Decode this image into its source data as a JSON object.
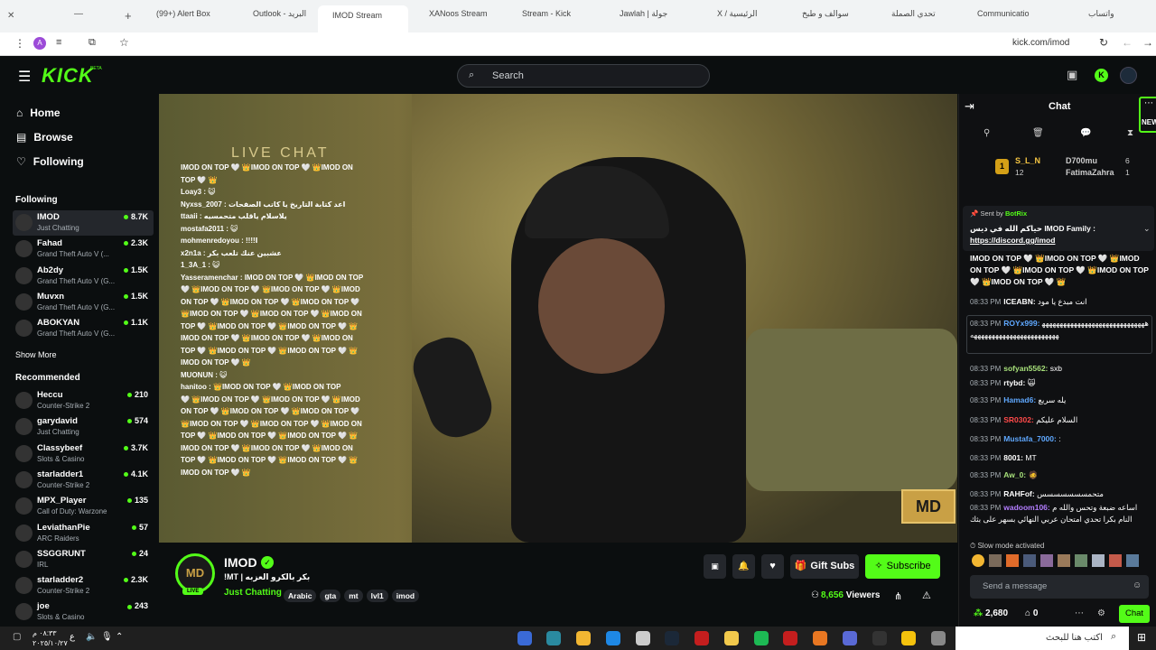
{
  "browser": {
    "tabs": [
      {
        "title": "(99+) Alert Box",
        "active": false
      },
      {
        "title": "Outlook - البريد",
        "active": false
      },
      {
        "title": "IMOD Stream",
        "active": true
      },
      {
        "title": "XANoos Stream",
        "active": false
      },
      {
        "title": "Stream - Kick",
        "active": false
      },
      {
        "title": "Jawlah | جولة",
        "active": false
      },
      {
        "title": "X / الرئيسية",
        "active": false
      },
      {
        "title": "سوالف و طبخ",
        "active": false
      },
      {
        "title": "تحدي الصملة",
        "active": false
      },
      {
        "title": "Communicatio",
        "active": false
      },
      {
        "title": "واتساب",
        "active": false
      }
    ],
    "url": "kick.com/imod"
  },
  "header": {
    "logo": "KICK",
    "logo_badge": "BETA",
    "search_placeholder": "Search"
  },
  "sidebar": {
    "nav": [
      "Home",
      "Browse",
      "Following"
    ],
    "following_title": "Following",
    "following": [
      {
        "name": "IMOD",
        "category": "Just Chatting",
        "viewers": "8.7K"
      },
      {
        "name": "Fahad",
        "category": "Grand Theft Auto V (...",
        "viewers": "2.3K"
      },
      {
        "name": "Ab2dy",
        "category": "Grand Theft Auto V (G...",
        "viewers": "1.5K"
      },
      {
        "name": "Muvxn",
        "category": "Grand Theft Auto V (G...",
        "viewers": "1.5K"
      },
      {
        "name": "ABOKYAN",
        "category": "Grand Theft Auto V (G...",
        "viewers": "1.1K"
      }
    ],
    "show_more": "Show More",
    "recommended_title": "Recommended",
    "recommended": [
      {
        "name": "Heccu",
        "category": "Counter-Strike 2",
        "viewers": "210"
      },
      {
        "name": "garydavid",
        "category": "Just Chatting",
        "viewers": "574"
      },
      {
        "name": "Classybeef",
        "category": "Slots & Casino",
        "viewers": "3.7K"
      },
      {
        "name": "starladder1",
        "category": "Counter-Strike 2",
        "viewers": "4.1K"
      },
      {
        "name": "MPX_Player",
        "category": "Call of Duty: Warzone",
        "viewers": "135"
      },
      {
        "name": "LeviathanPie",
        "category": "ARC Raiders",
        "viewers": "57"
      },
      {
        "name": "SSGGRUNT",
        "category": "IRL",
        "viewers": "24"
      },
      {
        "name": "starladder2",
        "category": "Counter-Strike 2",
        "viewers": "2.3K"
      },
      {
        "name": "joe",
        "category": "Slots & Casino",
        "viewers": "243"
      }
    ]
  },
  "video": {
    "overlay_title": "LIVE CHAT",
    "overlay_lines": [
      "IMOD ON TOP 🤍 👑IMOD ON TOP 🤍 👑IMOD ON",
      "TOP 🤍 👑",
      "Loay3 : 😺",
      "Nyxss_2007 : اعد كتابة التاريخ يا كاتب الصفحات",
      "ttaaii : يلاسلام ياقلب متحمسيه",
      "mostafa2011 : 😺",
      "mohmenredoyou : !!!!ا",
      "x2n1a : عشبين عنك تلعب بكر",
      "1_3A_1 : 😺",
      "Yasseramenchar : IMOD ON TOP 🤍 👑IMOD ON TOP",
      "🤍 👑IMOD ON TOP 🤍 👑IMOD ON TOP 🤍 👑IMOD",
      "ON TOP 🤍 👑IMOD ON TOP 🤍 👑IMOD ON TOP 🤍",
      "👑IMOD ON TOP 🤍 👑IMOD ON TOP 🤍 👑IMOD ON",
      "TOP 🤍 👑IMOD ON TOP 🤍 👑IMOD ON TOP 🤍 👑",
      "IMOD ON TOP 🤍 👑IMOD ON TOP 🤍 👑IMOD ON",
      "TOP 🤍 👑IMOD ON TOP 🤍 👑IMOD ON TOP 🤍 👑",
      "IMOD ON TOP 🤍 👑",
      "MUONUN : 😺",
      "hanitoo : 👑IMOD ON TOP 🤍 👑IMOD ON TOP",
      "🤍 👑IMOD ON TOP 🤍 👑IMOD ON TOP 🤍 👑IMOD",
      "ON TOP 🤍 👑IMOD ON TOP 🤍 👑IMOD ON TOP 🤍",
      "👑IMOD ON TOP 🤍 👑IMOD ON TOP 🤍 👑IMOD ON",
      "TOP 🤍 👑IMOD ON TOP 🤍 👑IMOD ON TOP 🤍 👑",
      "IMOD ON TOP 🤍 👑IMOD ON TOP 🤍 👑IMOD ON",
      "TOP 🤍 👑IMOD ON TOP 🤍 👑IMOD ON TOP 🤍 👑",
      "IMOD ON TOP 🤍 👑"
    ],
    "logo_text": "MD"
  },
  "stream": {
    "channel": "IMOD",
    "live_badge": "LIVE",
    "title": "!MT | بكر بالكرو العزبه",
    "category": "Just Chatting",
    "tags": [
      "Arabic",
      "gta",
      "mt",
      "lvl1",
      "imod"
    ],
    "viewers": "8,656",
    "viewers_label": "Viewers",
    "gift_subs": "Gift Subs",
    "subscribe": "Subscribe"
  },
  "chat": {
    "title": "Chat",
    "new_badge": "NEW",
    "leaderboard": [
      {
        "rank": "1",
        "name": "S_L_N",
        "count": "12"
      },
      {
        "rank": "",
        "name": "D700mu",
        "count": "6"
      },
      {
        "rank": "",
        "name": "FatimaZahra",
        "count": "1"
      }
    ],
    "pinned_by_label": "Sent by",
    "pinned_by": "BotRix",
    "pinned_text": "حياكم الله في ديس IMOD Family :",
    "pinned_link": "https://discord.gg/imod",
    "spam": "IMOD ON TOP 🤍 👑IMOD ON TOP 🤍 👑IMOD ON TOP 🤍 👑IMOD ON TOP 🤍 👑IMOD ON TOP 🤍 👑IMOD ON TOP 🤍 👑",
    "messages": [
      {
        "time": "08:33 PM",
        "user": "ICEABN:",
        "color": "#ffffff",
        "text": "انت مبدع يا مود"
      },
      {
        "time": "08:33 PM",
        "user": "ROYx999:",
        "color": "#5fa8ff",
        "text": "ههههههههههههههههههههههههههههههههههههههههههههههههههههههه"
      },
      {
        "time": "08:33 PM",
        "user": "sofyan5562:",
        "color": "#a7e07a",
        "text": "sxb"
      },
      {
        "time": "08:33 PM",
        "user": "rtybd:",
        "color": "#ffffff",
        "text": "🙀"
      },
      {
        "time": "08:33 PM",
        "user": "Hamad6:",
        "color": "#5fa8ff",
        "text": "يله سريع"
      },
      {
        "time": "08:33 PM",
        "user": "SR0302:",
        "color": "#ff4a4a",
        "text": "السلام عليكم"
      },
      {
        "time": "08:33 PM",
        "user": "Mustafa_7000:",
        "color": "#5fa8ff",
        "text": ":"
      },
      {
        "time": "08:33 PM",
        "user": "8001:",
        "color": "#ffffff",
        "text": "MT"
      },
      {
        "time": "08:33 PM",
        "user": "Aw_0:",
        "color": "#a7e07a",
        "text": "🧔"
      },
      {
        "time": "08:33 PM",
        "user": "RAHFof:",
        "color": "#ffffff",
        "text": "متحمسسسسسسس"
      },
      {
        "time": "08:33 PM",
        "user": "wadoom106:",
        "color": "#b37dff",
        "text": "اساعه ضبعة وتحس والله م النام بكرا تحدي امتحان عربي النهائي بسهر على بثك"
      }
    ],
    "slow_mode": "Slow mode activated",
    "input_placeholder": "Send a message",
    "points": "2,680",
    "gifts": "0",
    "send_button": "Chat"
  },
  "taskbar": {
    "search_placeholder": "اكتب هنا للبحث",
    "time": "٠٨:٣٣ م",
    "date": "٢٠٢٥/١٠/٢٧",
    "lang": "ع"
  }
}
